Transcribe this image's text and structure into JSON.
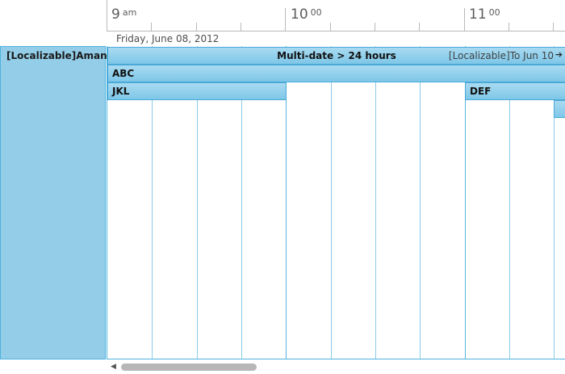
{
  "ruler": {
    "hours": [
      {
        "hour": "9",
        "suffix": "am"
      },
      {
        "hour": "10",
        "suffix": "00"
      },
      {
        "hour": "11",
        "suffix": "00"
      }
    ]
  },
  "date_header": "Friday, June 08, 2012",
  "resource": {
    "name": "[Localizable]Amanda"
  },
  "appointments": {
    "multi_date": {
      "title": "Multi-date > 24 hours",
      "continues": "[Localizable]To Jun 10",
      "arrow_icon": "arrow-right-icon"
    },
    "abc": {
      "title": "ABC"
    },
    "jkl": {
      "title": "JKL"
    },
    "def": {
      "title": "DEF"
    }
  },
  "colors": {
    "resource_bg": "#93cde8",
    "appointment_bg": "#7ec7e8",
    "grid_line": "#8ccbe9"
  }
}
